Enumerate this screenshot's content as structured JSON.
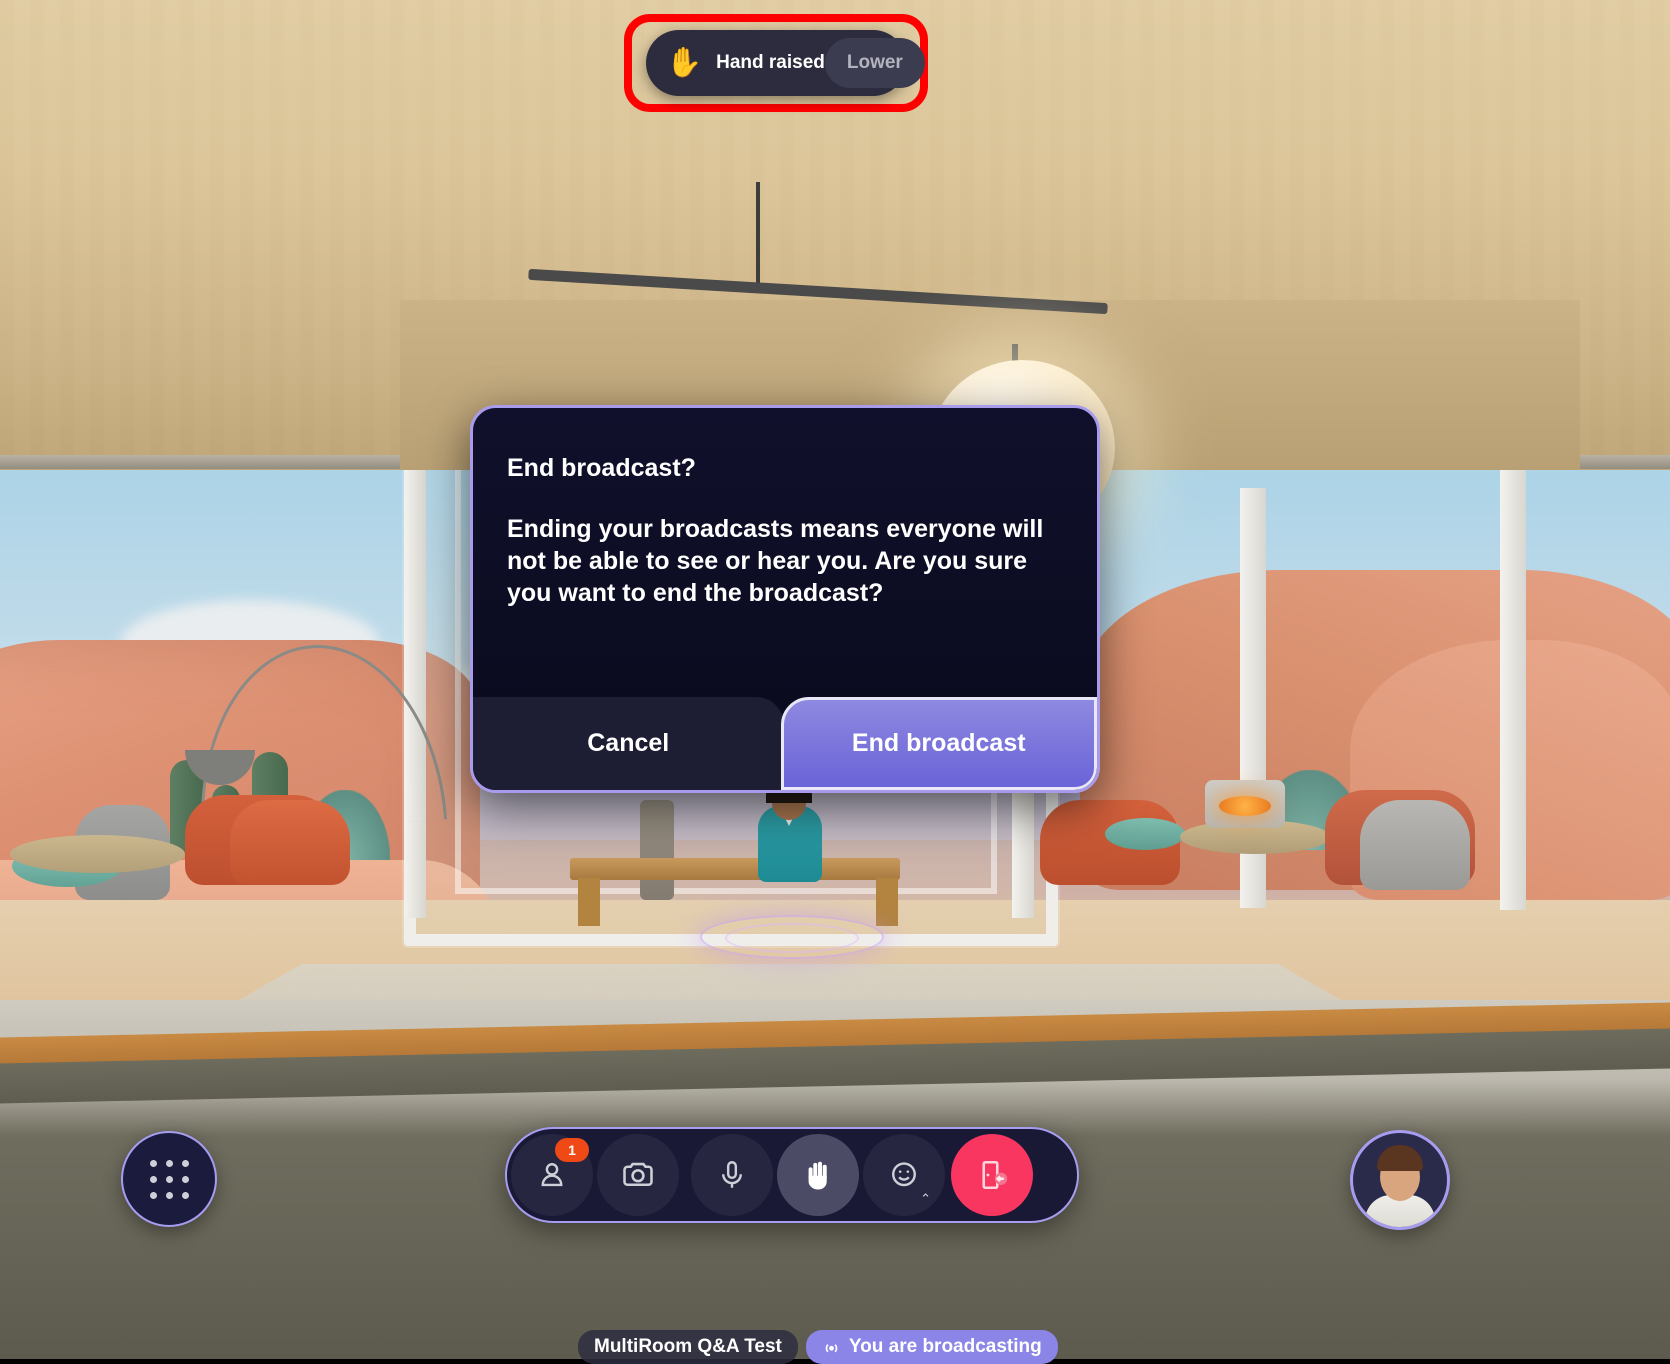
{
  "app": {
    "environment_name": "desert-mesa-vr-lounge",
    "accent_purple": "#a79df0",
    "highlight_red": "#ff0000",
    "danger_red": "#f9365f",
    "badge_orange": "#ef4a16"
  },
  "hand_toast": {
    "emoji": "✋",
    "label": "Hand raised",
    "lower_button": "Lower"
  },
  "modal": {
    "title": "End broadcast?",
    "body": "Ending your broadcasts means everyone will not be able to see or hear you. Are you sure you want to end the broadcast?",
    "cancel_label": "Cancel",
    "confirm_label": "End broadcast"
  },
  "toolbar": {
    "grid_button": "apps-grid",
    "items": [
      {
        "name": "participants",
        "icon": "person-icon",
        "badge": "1"
      },
      {
        "name": "camera",
        "icon": "camera-icon",
        "badge": ""
      },
      {
        "name": "microphone",
        "icon": "microphone-icon",
        "badge": ""
      },
      {
        "name": "raise-hand",
        "icon": "hand-icon",
        "badge": "",
        "active": true
      },
      {
        "name": "reactions",
        "icon": "smiley-icon",
        "badge": "",
        "caret": "⌃"
      },
      {
        "name": "leave",
        "icon": "leave-door-icon",
        "badge": ""
      }
    ]
  },
  "status": {
    "room_name": "MultiRoom Q&A Test",
    "broadcast_icon": "broadcast-icon",
    "broadcast_label": "You are broadcasting"
  },
  "avatar": {
    "name": "self-avatar"
  }
}
